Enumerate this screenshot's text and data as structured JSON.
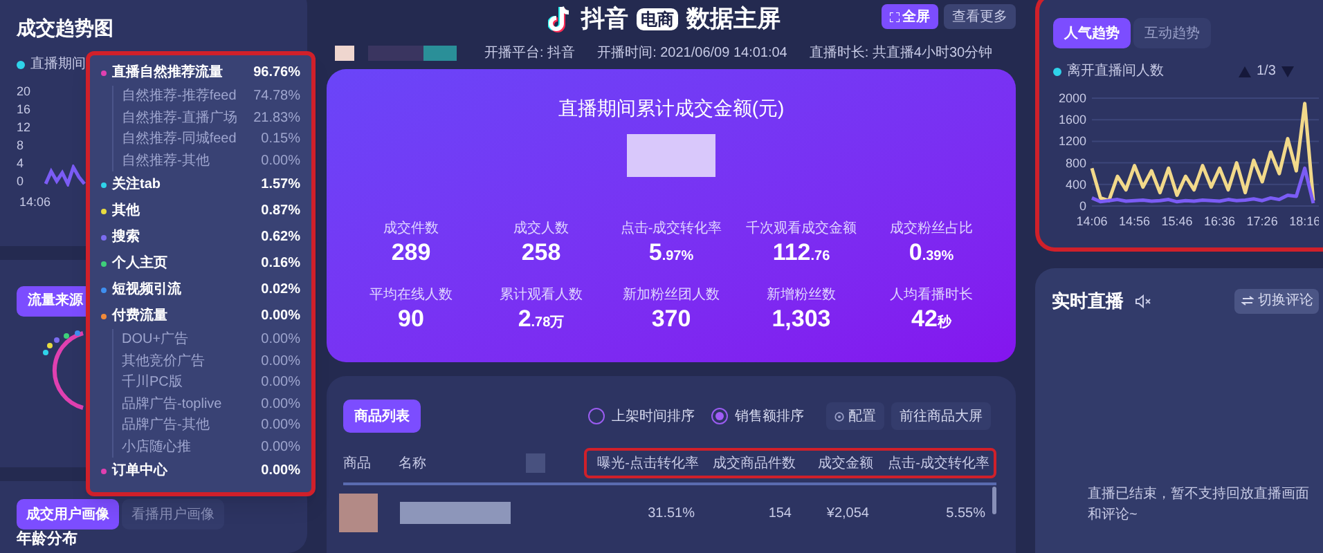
{
  "trend_card": {
    "title": "成交趋势图",
    "legend": "直播期间",
    "y_ticks": [
      "20",
      "16",
      "12",
      "8",
      "4",
      "0"
    ],
    "x_ticks": [
      "14:06"
    ]
  },
  "traffic_card": {
    "button": "流量来源"
  },
  "portrait_card": {
    "tabs": [
      {
        "label": "成交用户画像",
        "selected": true
      },
      {
        "label": "看播用户画像",
        "selected": false
      }
    ],
    "section": "年龄分布"
  },
  "traffic_popup": {
    "highlighted": true,
    "items": [
      {
        "label": "直播自然推荐流量",
        "value": "96.76%",
        "color": "#e040b0",
        "children": [
          {
            "label": "自然推荐-推荐feed",
            "value": "74.78%"
          },
          {
            "label": "自然推荐-直播广场",
            "value": "21.83%"
          },
          {
            "label": "自然推荐-同城feed",
            "value": "0.15%"
          },
          {
            "label": "自然推荐-其他",
            "value": "0.00%"
          }
        ]
      },
      {
        "label": "关注tab",
        "value": "1.57%",
        "color": "#2fd3ea"
      },
      {
        "label": "其他",
        "value": "0.87%",
        "color": "#e8dc40"
      },
      {
        "label": "搜索",
        "value": "0.62%",
        "color": "#7b6cf0"
      },
      {
        "label": "个人主页",
        "value": "0.16%",
        "color": "#3ecf7a"
      },
      {
        "label": "短视频引流",
        "value": "0.02%",
        "color": "#3f8ff0"
      },
      {
        "label": "付费流量",
        "value": "0.00%",
        "color": "#f08a3a",
        "children": [
          {
            "label": "DOU+广告",
            "value": "0.00%"
          },
          {
            "label": "其他竞价广告",
            "value": "0.00%"
          },
          {
            "label": "千川PC版",
            "value": "0.00%"
          },
          {
            "label": "品牌广告-toplive",
            "value": "0.00%"
          },
          {
            "label": "品牌广告-其他",
            "value": "0.00%"
          },
          {
            "label": "小店随心推",
            "value": "0.00%"
          }
        ]
      },
      {
        "label": "订单中心",
        "value": "0.00%",
        "color": "#e040b0"
      }
    ]
  },
  "header": {
    "brand": "抖音",
    "badge": "电商",
    "title": "数据主屏",
    "buttons": [
      {
        "label": "全屏",
        "kind": "fullscreen"
      },
      {
        "label": "查看更多",
        "kind": "plain"
      }
    ],
    "info": [
      {
        "label": "开播平台: 抖音"
      },
      {
        "label": "开播时间: 2021/06/09 14:01:04"
      },
      {
        "label": "直播时长: 共直播4小时30分钟"
      }
    ]
  },
  "summary": {
    "title": "直播期间累计成交金额(元)",
    "metrics": [
      {
        "label": "成交件数",
        "value": "289"
      },
      {
        "label": "成交人数",
        "value": "258"
      },
      {
        "label": "点击-成交转化率",
        "value": "5",
        "unit": ".97%"
      },
      {
        "label": "千次观看成交金额",
        "value": "112",
        "unit": ".76"
      },
      {
        "label": "成交粉丝占比",
        "value": "0",
        "unit": ".39%"
      },
      {
        "label": "平均在线人数",
        "value": "90"
      },
      {
        "label": "累计观看人数",
        "value": "2",
        "unit": ".78万"
      },
      {
        "label": "新加粉丝团人数",
        "value": "370"
      },
      {
        "label": "新增粉丝数",
        "value": "1,303"
      },
      {
        "label": "人均看播时长",
        "value": "42",
        "unit": "秒"
      }
    ]
  },
  "products": {
    "button": "商品列表",
    "sort_options": [
      {
        "label": "上架时间排序",
        "selected": false
      },
      {
        "label": "销售额排序",
        "selected": true
      }
    ],
    "actions": [
      {
        "label": "配置",
        "kind": "settings"
      },
      {
        "label": "前往商品大屏",
        "kind": "plain"
      }
    ],
    "columns": [
      {
        "label": "商品",
        "highlighted": false
      },
      {
        "label": "名称",
        "highlighted": false
      },
      {
        "label": "曝光-点击转化率",
        "highlighted": true
      },
      {
        "label": "成交商品件数",
        "highlighted": true
      },
      {
        "label": "成交金额",
        "highlighted": true
      },
      {
        "label": "点击-成交转化率",
        "highlighted": true
      }
    ],
    "rows": [
      {
        "cells": [
          "",
          "",
          "31.51%",
          "154",
          "¥2,054",
          "5.55%"
        ]
      }
    ]
  },
  "popularity": {
    "highlighted": true,
    "tabs": [
      {
        "label": "人气趋势",
        "selected": true
      },
      {
        "label": "互动趋势",
        "selected": false
      }
    ],
    "page": "1/3",
    "chart_data": {
      "type": "line",
      "categories": [
        "14:06",
        null,
        null,
        null,
        null,
        "14:56",
        null,
        null,
        null,
        null,
        "15:46",
        null,
        null,
        null,
        null,
        "16:36",
        null,
        null,
        null,
        null,
        "17:26",
        null,
        null,
        null,
        null,
        "18:16",
        null
      ],
      "grid": true,
      "ylim": [
        0,
        2000
      ],
      "yticks": [
        0,
        400,
        800,
        1200,
        1600,
        2000
      ],
      "series": [
        {
          "name": "离开直播间人数",
          "color": "#f2d98a",
          "values": [
            700,
            150,
            100,
            550,
            300,
            750,
            350,
            650,
            250,
            700,
            200,
            550,
            300,
            750,
            350,
            700,
            300,
            800,
            250,
            850,
            450,
            1000,
            600,
            1250,
            650,
            1900,
            100
          ]
        },
        {
          "color": "#7b5cf5",
          "values": [
            150,
            80,
            100,
            120,
            90,
            100,
            110,
            90,
            100,
            120,
            80,
            100,
            90,
            110,
            100,
            90,
            120,
            100,
            110,
            130,
            100,
            150,
            120,
            200,
            180,
            700,
            50
          ]
        }
      ]
    }
  },
  "live": {
    "title": "实时直播",
    "button": "切换评论",
    "message": "直播已结束，暂不支持回放直播画面和评论~"
  }
}
